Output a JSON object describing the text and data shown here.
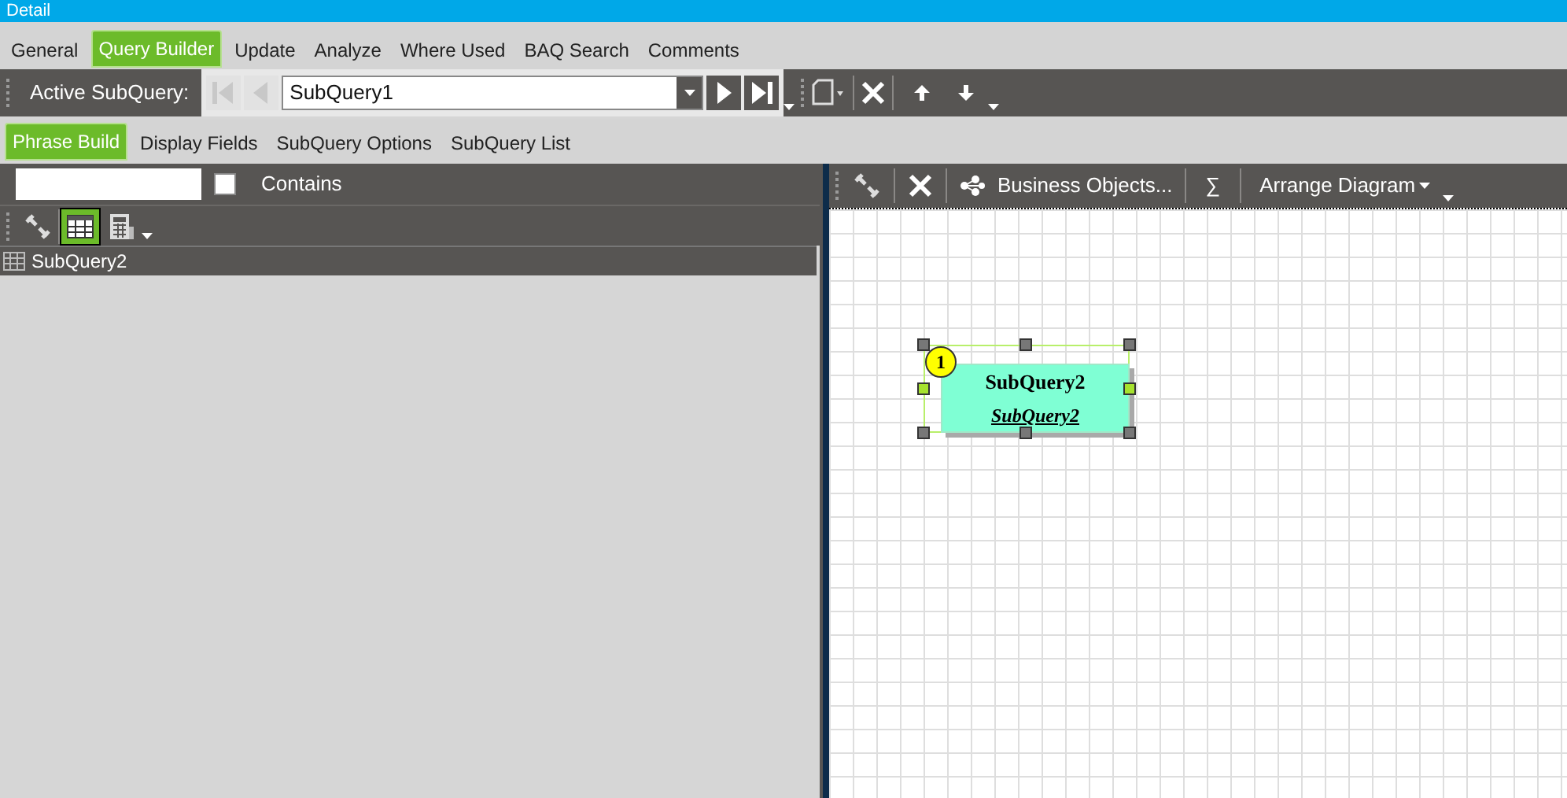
{
  "window": {
    "title": "Detail"
  },
  "tabs": [
    {
      "label": "General",
      "selected": false
    },
    {
      "label": "Query Builder",
      "selected": true
    },
    {
      "label": "Update",
      "selected": false
    },
    {
      "label": "Analyze",
      "selected": false
    },
    {
      "label": "Where Used",
      "selected": false
    },
    {
      "label": "BAQ Search",
      "selected": false
    },
    {
      "label": "Comments",
      "selected": false
    }
  ],
  "subquery_toolbar": {
    "label": "Active SubQuery:",
    "value": "SubQuery1",
    "nav_buttons": [
      {
        "kind": "first",
        "disabled": true
      },
      {
        "kind": "prev",
        "disabled": true
      },
      {
        "kind": "next",
        "disabled": false
      },
      {
        "kind": "last",
        "disabled": false
      }
    ]
  },
  "subtabs": [
    {
      "label": "Phrase Build",
      "selected": true
    },
    {
      "label": "Display Fields",
      "selected": false
    },
    {
      "label": "SubQuery Options",
      "selected": false
    },
    {
      "label": "SubQuery List",
      "selected": false
    }
  ],
  "filter": {
    "contains_label": "Contains",
    "contains_checked": false
  },
  "view_buttons": [
    {
      "kind": "link",
      "selected": false
    },
    {
      "kind": "table",
      "selected": true
    },
    {
      "kind": "calc",
      "selected": false
    }
  ],
  "tree": [
    {
      "label": "SubQuery2",
      "selected": true
    }
  ],
  "diagram_toolbar": {
    "business_objects": "Business Objects...",
    "sigma": "∑",
    "arrange": "Arrange Diagram"
  },
  "diagram": {
    "nodes": [
      {
        "number": "1",
        "title": "SubQuery2",
        "alias": "SubQuery2",
        "selected": true
      }
    ]
  }
}
